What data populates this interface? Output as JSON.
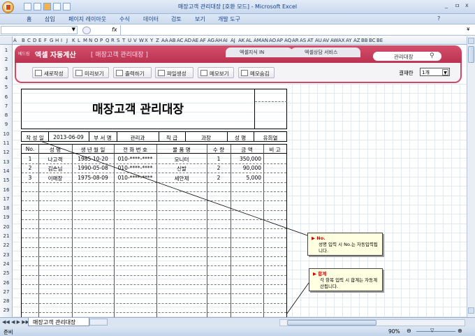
{
  "window": {
    "title": "매장고객 관리대장 [호환 모드] - Microsoft Excel",
    "controls": [
      "_",
      "ㅁ",
      "x"
    ]
  },
  "ribbon_tabs": [
    "홈",
    "삽입",
    "페이지 레이아웃",
    "수식",
    "데이터",
    "검토",
    "보기",
    "개발 도구"
  ],
  "formula_bar": {
    "fx": "fx",
    "value": ""
  },
  "columns": [
    "A",
    "B",
    "C",
    "D",
    "E",
    "F",
    "G",
    "H",
    "I",
    "J",
    "K",
    "L",
    "M",
    "N",
    "O",
    "P",
    "Q",
    "R",
    "S",
    "T",
    "U",
    "V",
    "W",
    "X",
    "Y",
    "Z",
    "AA",
    "AB",
    "AC",
    "AD",
    "AE",
    "AF",
    "AG",
    "AH",
    "AI",
    "AJ",
    "AK",
    "AL",
    "AM",
    "AN",
    "AO",
    "AP",
    "AQ",
    "AR",
    "AS",
    "AT",
    "AU",
    "AV",
    "AW",
    "AX",
    "AY",
    "AZ",
    "BB",
    "BC",
    "BE"
  ],
  "rows": [
    "1",
    "2",
    "3",
    "4",
    "5",
    "6",
    "7",
    "8",
    "9",
    "10",
    "11",
    "12",
    "13",
    "14",
    "15",
    "16",
    "17",
    "18",
    "19",
    "20",
    "21",
    "22",
    "23",
    "24",
    "25",
    "26",
    "27",
    "28",
    "29"
  ],
  "app": {
    "brand_small": "베드림",
    "brand": "엑셀 자동계산",
    "doc_title": "[ 매장고객 관리대장 ]",
    "link1": "엑셀지식 IN",
    "link2": "엑셀상담 서비스",
    "search": "관리대장",
    "buttons": [
      "새로작성",
      "미리보기",
      "출력하기",
      "파일생성",
      "메모보기",
      "메모숨김"
    ],
    "approval_label": "결재란",
    "approval_value": "1개"
  },
  "form": {
    "title": "매장고객 관리대장",
    "meta": {
      "date_label": "작 성 일",
      "date": "2013-06-09",
      "dept_label": "부 서 명",
      "dept": "관리과",
      "rank_label": "직 급",
      "rank": "과장",
      "name_label": "성 명",
      "name": "유희열"
    },
    "headers": [
      "No.",
      "성 명",
      "생 년 월 일",
      "전 화 번 호",
      "물 품 명",
      "수 량",
      "금 액",
      "비 고"
    ],
    "records": [
      {
        "no": "1",
        "name": "나고객",
        "birth": "1985-10-20",
        "phone": "010-****-****",
        "item": "모니터",
        "qty": "1",
        "amount": "350,000",
        "note": ""
      },
      {
        "no": "2",
        "name": "김손님",
        "birth": "1990-05-08",
        "phone": "010-****-****",
        "item": "신발",
        "qty": "2",
        "amount": "90,000",
        "note": ""
      },
      {
        "no": "3",
        "name": "이매장",
        "birth": "1975-08-09",
        "phone": "010-****-****",
        "item": "세안제",
        "qty": "2",
        "amount": "5,000",
        "note": ""
      }
    ]
  },
  "comments": [
    {
      "head": "▶ No.",
      "body": "성명 입력 시 No.는 자동입력됩니다."
    },
    {
      "head": "▶ 합계",
      "body": "각 항목 입력 시 합계는 자동계산됩니다."
    }
  ],
  "sheet_tab": "매장고객 관리대장",
  "status": {
    "ready": "준비",
    "zoom": "90%"
  },
  "colors": {
    "banner": "#c23d5d",
    "accent": "#15428b"
  }
}
